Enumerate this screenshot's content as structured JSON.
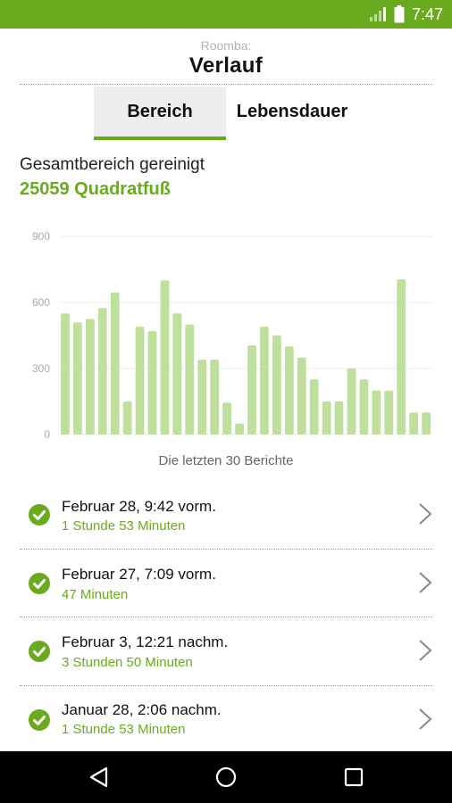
{
  "status_bar": {
    "time": "7:47",
    "accent_color": "#6aaa1f"
  },
  "header": {
    "subtitle": "Roomba:",
    "title": "Verlauf"
  },
  "tabs": [
    {
      "label": "Bereich",
      "active": true
    },
    {
      "label": "Lebensdauer",
      "active": false
    }
  ],
  "summary": {
    "label": "Gesamtbereich gereinigt",
    "value": "25059 Quadratfuß"
  },
  "chart_data": {
    "type": "bar",
    "caption": "Die letzten 30 Berichte",
    "yticks": [
      "0",
      "300",
      "600",
      "900"
    ],
    "ylim": [
      0,
      900
    ],
    "grid": true,
    "bar_color": "#bfdf9c",
    "values": [
      550,
      510,
      525,
      575,
      645,
      150,
      490,
      470,
      700,
      550,
      500,
      340,
      340,
      145,
      50,
      405,
      490,
      450,
      400,
      350,
      250,
      150,
      150,
      300,
      250,
      200,
      200,
      705,
      100,
      100
    ]
  },
  "history": [
    {
      "date": "Februar 28, 9:42 vorm.",
      "duration": "1 Stunde 53 Minuten",
      "status_icon": "check-circle-icon"
    },
    {
      "date": "Februar 27, 7:09 vorm.",
      "duration": "47 Minuten",
      "status_icon": "check-circle-icon"
    },
    {
      "date": "Februar 3, 12:21 nachm.",
      "duration": "3 Stunden 50 Minuten",
      "status_icon": "check-circle-icon"
    },
    {
      "date": "Januar 28, 2:06 nachm.",
      "duration": "1 Stunde 53 Minuten",
      "status_icon": "check-circle-icon"
    }
  ]
}
